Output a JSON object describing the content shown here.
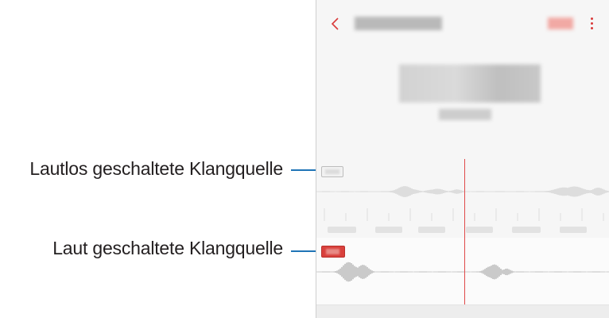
{
  "callouts": {
    "muted_source": "Lautlos geschaltete Klangquelle",
    "unmuted_source": "Laut geschaltete Klangquelle"
  },
  "app": {
    "back_icon": "chevron-left-icon",
    "menu_icon": "more-vertical-icon"
  },
  "tracks": {
    "muted_state": "muted",
    "unmuted_state": "unmuted"
  },
  "colors": {
    "leader_line": "#1f74b6",
    "accent": "#d93a3a",
    "playhead": "#e04a4a",
    "muted_toggle": "#f0f0f0",
    "unmuted_toggle": "#d9403c"
  }
}
